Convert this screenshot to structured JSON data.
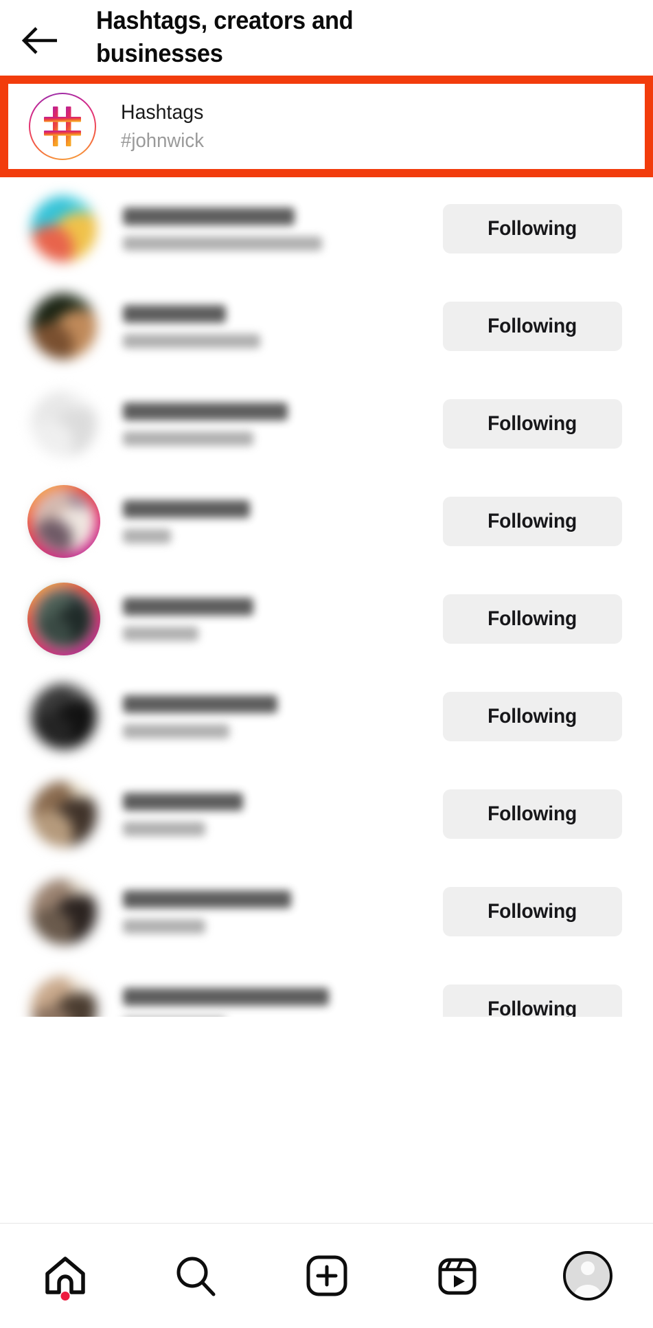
{
  "header": {
    "title": "Hashtags, creators and businesses",
    "back_icon": "arrow-left-icon"
  },
  "highlighted_result": {
    "highlight_color": "#F23C0C",
    "icon": "hashtag-icon",
    "title": "Hashtags",
    "subtitle": "#johnwick"
  },
  "user_list": {
    "follow_label": "Following",
    "rows": [
      {
        "username": "██████████████",
        "fullname": "███████████████",
        "button": "Following",
        "ring": false,
        "avatar_colors": [
          "#4fd1e0",
          "#35c3d8",
          "#f0c24a",
          "#e8644c"
        ]
      },
      {
        "username": "████████",
        "fullname": "████████████",
        "button": "Following",
        "ring": false,
        "avatar_colors": [
          "#2f3b28",
          "#1b2414",
          "#c08a5a",
          "#7a5030"
        ]
      },
      {
        "username": "████████████",
        "fullname": "████████████",
        "button": "Following",
        "ring": false,
        "avatar_colors": [
          "#f2f2f2",
          "#e8e8e8",
          "#dcdcdc",
          "#efefef"
        ]
      },
      {
        "username": "██████████",
        "fullname": "█████",
        "button": "Following",
        "ring": true,
        "avatar_colors": [
          "#8e7b8d",
          "#d2b8ae",
          "#efe6e0",
          "#6f5a66"
        ]
      },
      {
        "username": "██████████",
        "fullname": "██████",
        "button": "Following",
        "ring": true,
        "avatar_colors": [
          "#2d3b3d",
          "#4c5f56",
          "#1f2a28",
          "#3a4a44"
        ]
      },
      {
        "username": "████████████",
        "fullname": "████████",
        "button": "Following",
        "ring": false,
        "avatar_colors": [
          "#5a5a5a",
          "#3a3a3a",
          "#121212",
          "#242424"
        ]
      },
      {
        "username": "██████████",
        "fullname": "███████",
        "button": "Following",
        "ring": false,
        "avatar_colors": [
          "#e6dcc8",
          "#8a6b4f",
          "#40332a",
          "#b59a7c"
        ]
      },
      {
        "username": "██████████████",
        "fullname": "███████",
        "button": "Following",
        "ring": false,
        "avatar_colors": [
          "#dcd2c4",
          "#9a8270",
          "#2b2320",
          "#6a5a4c"
        ]
      },
      {
        "username": "█████████████████",
        "fullname": "███████",
        "button": "Following",
        "ring": false,
        "avatar_colors": [
          "#efe4d6",
          "#c9a98c",
          "#4a3c30",
          "#8c7360"
        ]
      }
    ]
  },
  "bottom_nav": {
    "items": [
      {
        "icon": "home-icon",
        "active": true,
        "badge": true
      },
      {
        "icon": "search-icon",
        "active": false,
        "badge": false
      },
      {
        "icon": "new-post-icon",
        "active": false,
        "badge": false
      },
      {
        "icon": "reels-icon",
        "active": false,
        "badge": false
      },
      {
        "icon": "profile-avatar-icon",
        "active": false,
        "badge": false
      }
    ],
    "badge_color": "#ED1B3E"
  }
}
